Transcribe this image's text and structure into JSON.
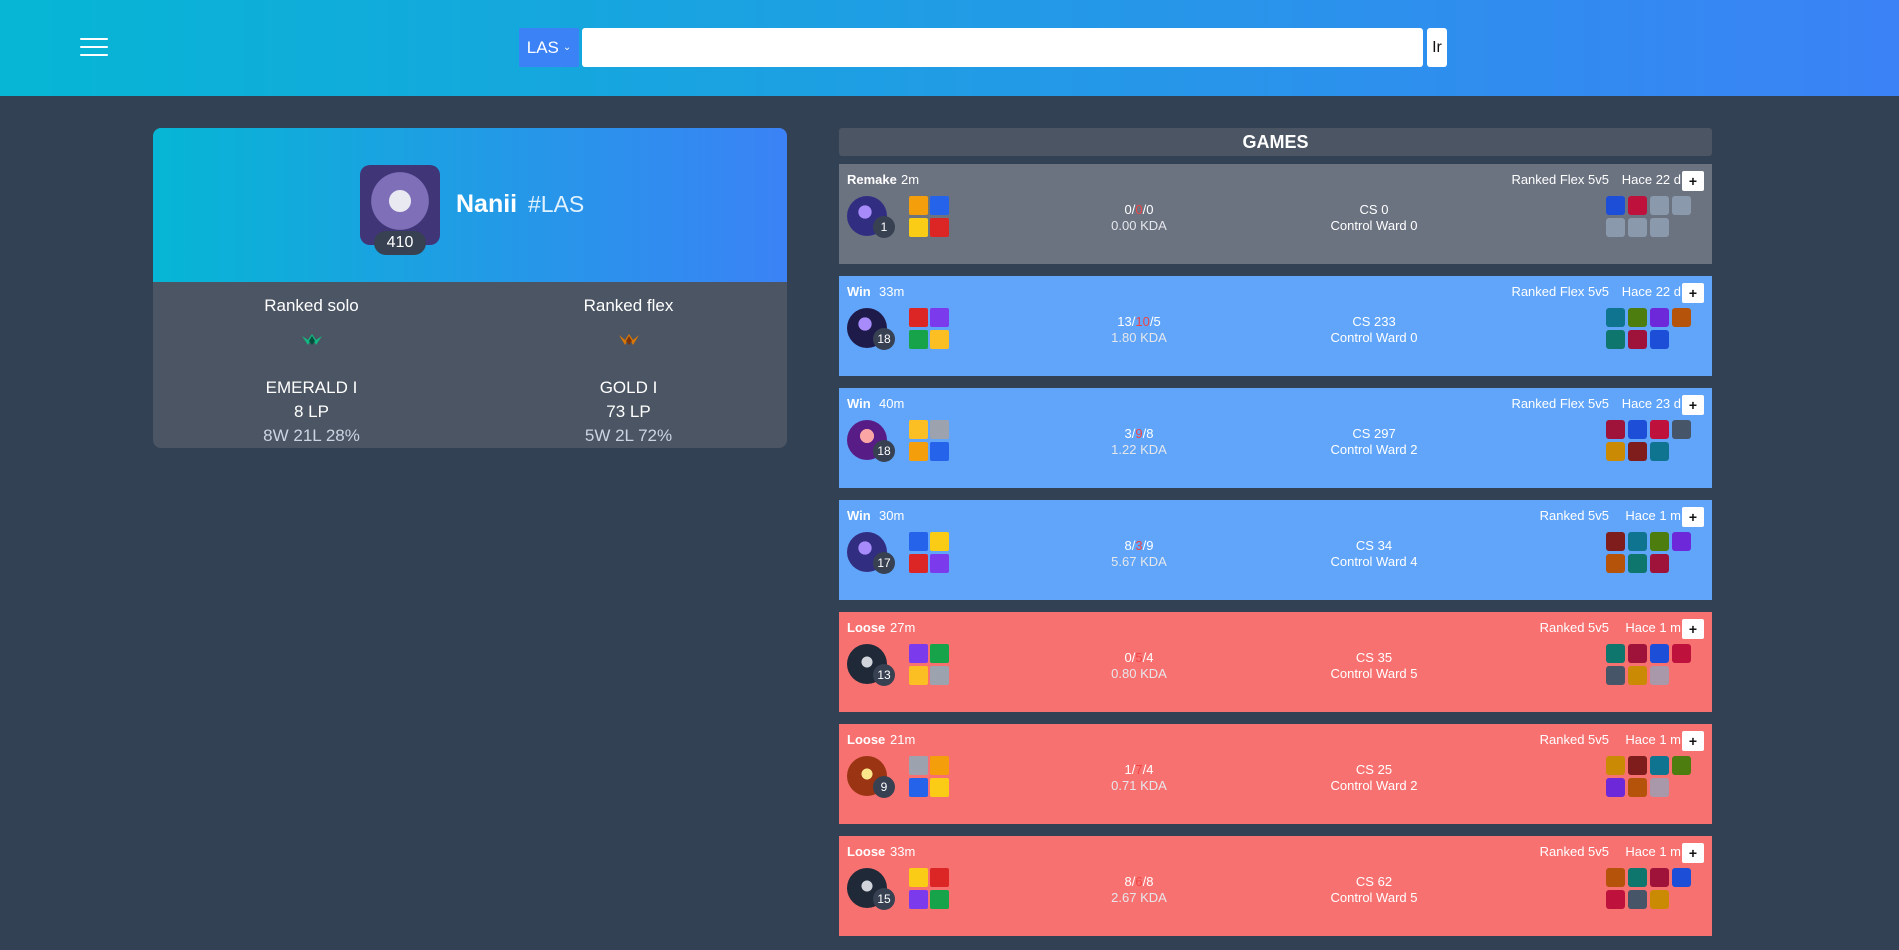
{
  "header": {
    "menu_icon": "hamburger-menu-icon",
    "region": "LAS",
    "search_value": "",
    "search_placeholder": "",
    "go_label": "Ir"
  },
  "profile": {
    "name": "Nanii",
    "tag": "#LAS",
    "level": "410",
    "ranks": [
      {
        "queue": "Ranked solo",
        "emblem": "emerald-emblem-icon",
        "tier": "EMERALD I",
        "lp": "8 LP",
        "record": "8W 21L 28%"
      },
      {
        "queue": "Ranked flex",
        "emblem": "gold-emblem-icon",
        "tier": "GOLD I",
        "lp": "73 LP",
        "record": "5W 2L 72%"
      }
    ]
  },
  "games_title": "GAMES",
  "games": [
    {
      "result": "Remake",
      "duration": "2m",
      "queue": "Ranked Flex 5v5",
      "ago": "Hace 22 d",
      "expand": "+",
      "level": "1",
      "kills": "0",
      "deaths": "0",
      "assists": "0",
      "kda": "0.00 KDA",
      "cs": "CS 0",
      "ward": "Control Ward 0"
    },
    {
      "result": "Win",
      "duration": "33m",
      "queue": "Ranked Flex 5v5",
      "ago": "Hace 22 d",
      "expand": "+",
      "level": "18",
      "kills": "13",
      "deaths": "10",
      "assists": "5",
      "kda": "1.80 KDA",
      "cs": "CS 233",
      "ward": "Control Ward 0"
    },
    {
      "result": "Win",
      "duration": "40m",
      "queue": "Ranked Flex 5v5",
      "ago": "Hace 23 d",
      "expand": "+",
      "level": "18",
      "kills": "3",
      "deaths": "9",
      "assists": "8",
      "kda": "1.22 KDA",
      "cs": "CS 297",
      "ward": "Control Ward 2"
    },
    {
      "result": "Win",
      "duration": "30m",
      "queue": "Ranked 5v5",
      "ago": "Hace 1 m",
      "expand": "+",
      "level": "17",
      "kills": "8",
      "deaths": "3",
      "assists": "9",
      "kda": "5.67 KDA",
      "cs": "CS 34",
      "ward": "Control Ward 4"
    },
    {
      "result": "Loose",
      "duration": "27m",
      "queue": "Ranked 5v5",
      "ago": "Hace 1 m",
      "expand": "+",
      "level": "13",
      "kills": "0",
      "deaths": "5",
      "assists": "4",
      "kda": "0.80 KDA",
      "cs": "CS 35",
      "ward": "Control Ward 5"
    },
    {
      "result": "Loose",
      "duration": "21m",
      "queue": "Ranked 5v5",
      "ago": "Hace 1 m",
      "expand": "+",
      "level": "9",
      "kills": "1",
      "deaths": "7",
      "assists": "4",
      "kda": "0.71 KDA",
      "cs": "CS 25",
      "ward": "Control Ward 2"
    },
    {
      "result": "Loose",
      "duration": "33m",
      "queue": "Ranked 5v5",
      "ago": "Hace 1 m",
      "expand": "+",
      "level": "15",
      "kills": "8",
      "deaths": "6",
      "assists": "8",
      "kda": "2.67 KDA",
      "cs": "CS 62",
      "ward": "Control Ward 5"
    }
  ],
  "colors": {
    "header_from": "#06b6d4",
    "header_to": "#3b82f6",
    "background": "#334155",
    "remake": "#6b7280",
    "win": "#60a5fa",
    "loose": "#f87171"
  }
}
